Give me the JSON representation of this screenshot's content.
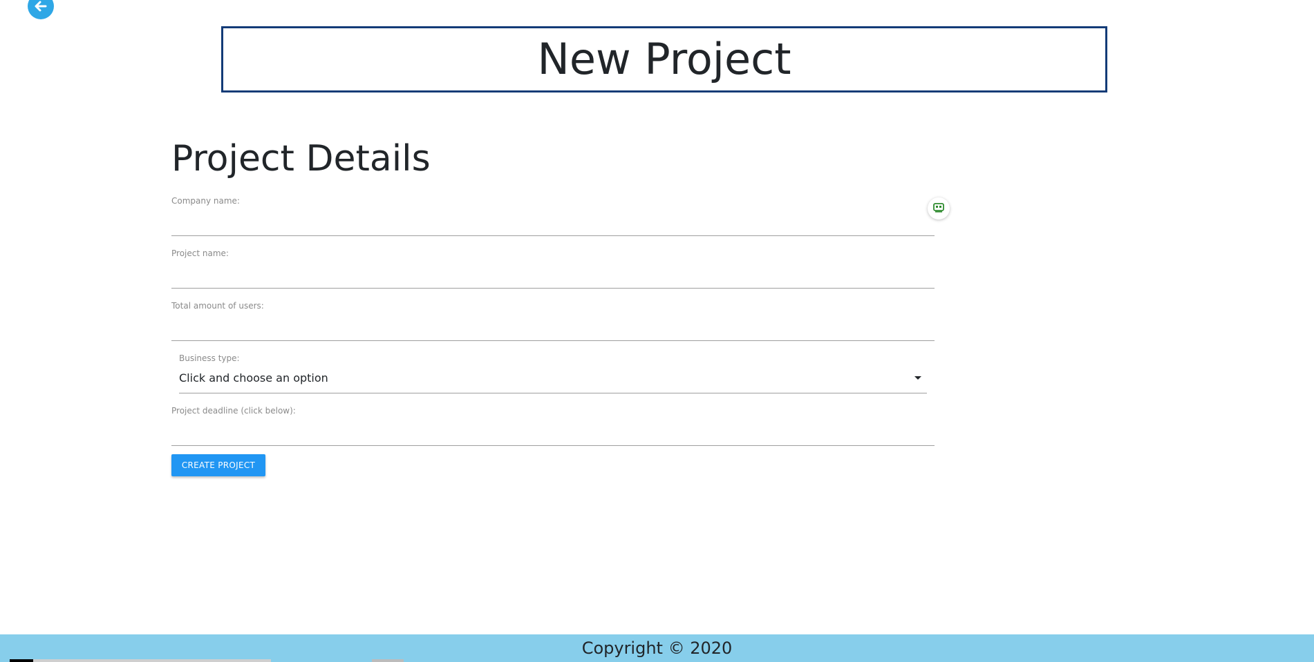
{
  "header": {
    "back_icon": "arrow-left-icon",
    "title": "New Project"
  },
  "form": {
    "section_title": "Project Details",
    "company_name": {
      "label": "Company name:",
      "value": "",
      "placeholder": ""
    },
    "project_name": {
      "label": "Project name:",
      "value": "",
      "placeholder": ""
    },
    "total_users": {
      "label": "Total amount of users:",
      "value": "",
      "placeholder": ""
    },
    "business_type": {
      "label": "Business type:",
      "selected": "Click and choose an option"
    },
    "deadline": {
      "label": "Project deadline (click below):",
      "value": "",
      "placeholder": ""
    },
    "submit_label": "CREATE PROJECT",
    "autofill_icon": "password-manager-icon"
  },
  "footer": {
    "text": "Copyright © 2020"
  },
  "colors": {
    "accent": "#2196f3",
    "title_border": "#133b77",
    "footer_bg": "#87ceeb",
    "back_button": "#2fa7e6"
  }
}
